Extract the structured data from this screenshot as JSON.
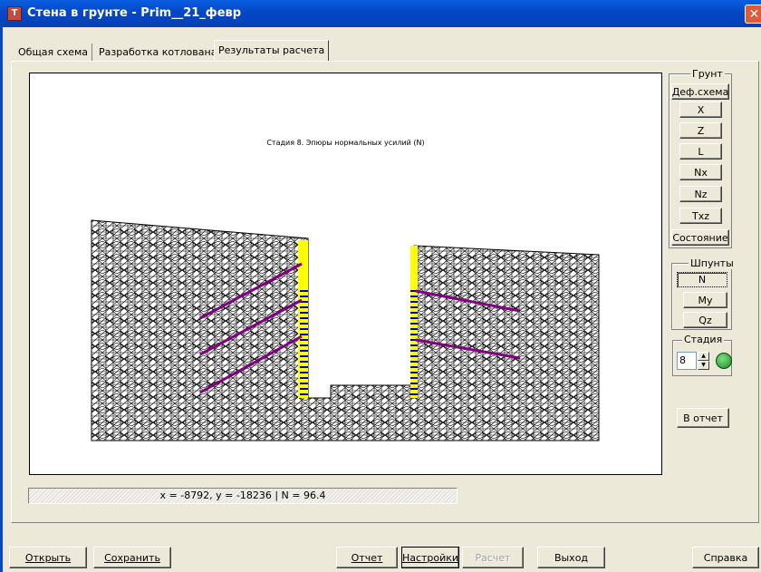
{
  "window": {
    "title": "Стена в грунте - Prim__21_февр",
    "close_icon": "close-icon"
  },
  "tabs": [
    {
      "label": "Общая схема"
    },
    {
      "label": "Разработка котлована"
    },
    {
      "label": "Результаты расчета"
    }
  ],
  "canvas": {
    "caption": "Стадия 8. Эпюры нормальных усилий (N)"
  },
  "right_panel": {
    "soil_group": "Грунт",
    "soil_buttons": [
      "Деф.схема",
      "X",
      "Z",
      "L",
      "Nx",
      "Nz",
      "Txz",
      "Состояние"
    ],
    "sheet_group": "Шпунты",
    "sheet_buttons": [
      "N",
      "My",
      "Qz"
    ],
    "stage_group": "Стадия",
    "stage_value": "8",
    "report_button": "В отчет"
  },
  "status": {
    "text": "x = -8792, y = -18236  |  N = 96.4"
  },
  "bottom": {
    "open": "Открыть",
    "save": "Сохранить",
    "report": "Отчет",
    "settings": "Настройки",
    "calc": "Расчет",
    "exit": "Выход",
    "help": "Справка"
  },
  "colors": {
    "titlebar": "#0447c7",
    "mesh": "#000000",
    "anchor": "#800080",
    "wall_epure": "#0000cc",
    "wall_fill": "#ffff00"
  }
}
